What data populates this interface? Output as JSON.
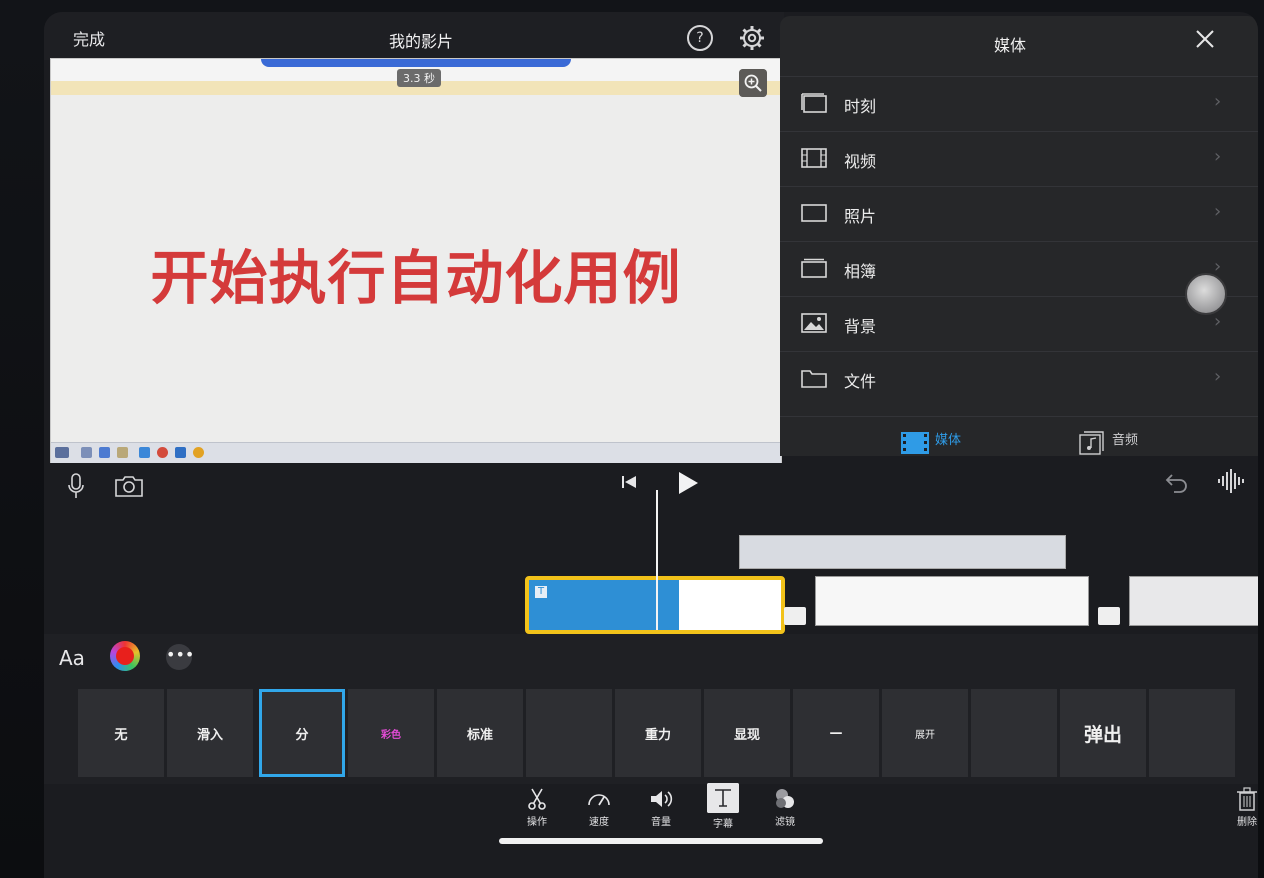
{
  "header": {
    "done_label": "完成",
    "project_title": "我的影片",
    "help_icon": "help-icon",
    "settings_icon": "gear-icon"
  },
  "preview": {
    "duration_badge": "3.3 秒",
    "overlay_title": "开始执行自动化用例",
    "zoom_icon": "magnify-icon",
    "title_color": "#d43a3a"
  },
  "media_panel": {
    "title": "媒体",
    "close_icon": "close-icon",
    "items": [
      {
        "label": "时刻",
        "icon": "moments-icon"
      },
      {
        "label": "视频",
        "icon": "film-icon"
      },
      {
        "label": "照片",
        "icon": "photo-icon"
      },
      {
        "label": "相簿",
        "icon": "album-icon"
      },
      {
        "label": "背景",
        "icon": "background-icon"
      },
      {
        "label": "文件",
        "icon": "folder-icon"
      }
    ],
    "tabs": [
      {
        "label": "媒体",
        "active": true
      },
      {
        "label": "音频",
        "active": false
      }
    ],
    "accent_color": "#2f9be6"
  },
  "transport": {
    "mic_icon": "microphone-icon",
    "camera_icon": "camera-icon",
    "skip_back_icon": "skip-back-icon",
    "play_icon": "play-icon",
    "undo_icon": "undo-icon",
    "audio_wave_icon": "waveform-icon"
  },
  "title_styles": {
    "font_label": "Aa",
    "more_label": "•••",
    "items": [
      {
        "label": "无"
      },
      {
        "label": "滑入"
      },
      {
        "label": "分",
        "selected": true
      },
      {
        "label": "彩色"
      },
      {
        "label": "标准"
      },
      {
        "label": ""
      },
      {
        "label": "重力"
      },
      {
        "label": "显现"
      },
      {
        "label": "—"
      },
      {
        "label": "展开"
      },
      {
        "label": ""
      },
      {
        "label": "弹出"
      },
      {
        "label": ""
      }
    ],
    "selected_border_color": "#31a7ea"
  },
  "toolbar": {
    "items": [
      {
        "label": "操作",
        "icon": "scissors-icon"
      },
      {
        "label": "速度",
        "icon": "speedometer-icon"
      },
      {
        "label": "音量",
        "icon": "speaker-icon"
      },
      {
        "label": "字幕",
        "icon": "text-icon",
        "active": true
      },
      {
        "label": "滤镜",
        "icon": "filter-icon"
      }
    ],
    "delete_label": "删除"
  }
}
